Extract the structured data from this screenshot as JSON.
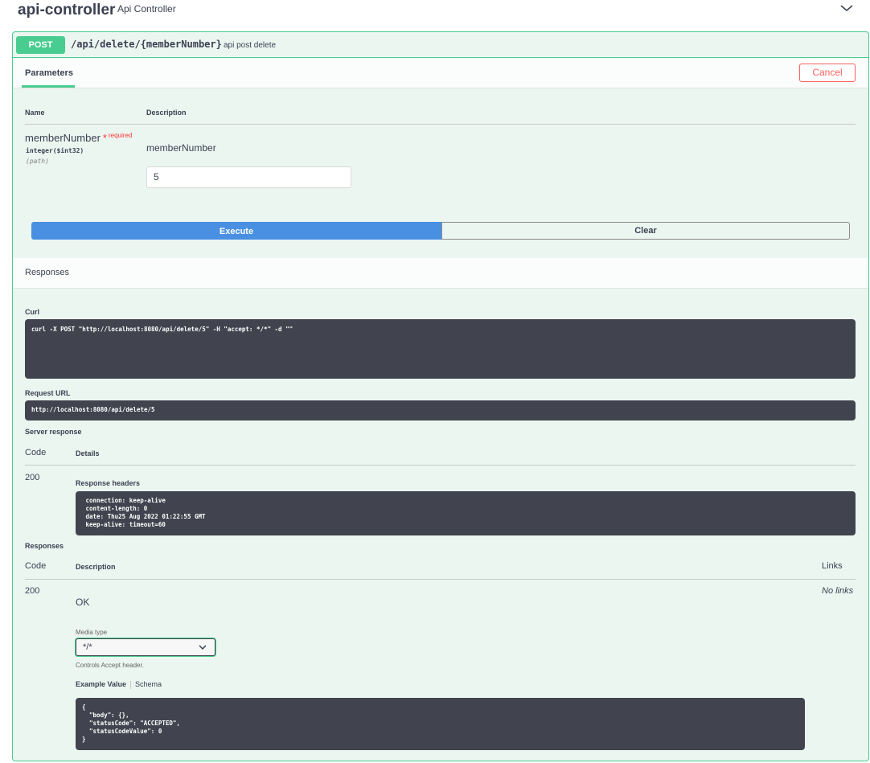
{
  "tag": {
    "name": "api-controller",
    "description": "Api Controller"
  },
  "operation": {
    "method": "POST",
    "path": "/api/delete/{memberNumber}",
    "summary": "api post delete"
  },
  "parameters": {
    "tab_label": "Parameters",
    "cancel_label": "Cancel",
    "col_name": "Name",
    "col_description": "Description",
    "items": [
      {
        "name": "memberNumber",
        "required_star": "*",
        "required_label": "required",
        "type": "integer($int32)",
        "in": "(path)",
        "description": "memberNumber",
        "value": "5"
      }
    ]
  },
  "actions": {
    "execute_label": "Execute",
    "clear_label": "Clear"
  },
  "responses_section": {
    "title": "Responses",
    "curl_label": "Curl",
    "curl_command": "curl -X POST \"http://localhost:8080/api/delete/5\" -H \"accept: */*\" -d \"\"",
    "request_url_label": "Request URL",
    "request_url": "http://localhost:8080/api/delete/5",
    "server_response_label": "Server response",
    "col_code": "Code",
    "col_details": "Details",
    "server_code": "200",
    "response_headers_label": "Response headers",
    "response_headers": " connection: keep-alive \n content-length: 0 \n date: Thu25 Aug 2022 01:22:55 GMT \n keep-alive: timeout=60 "
  },
  "documented_responses": {
    "title": "Responses",
    "col_code": "Code",
    "col_description": "Description",
    "col_links": "Links",
    "items": [
      {
        "code": "200",
        "description": "OK",
        "links": "No links",
        "media_type_label": "Media type",
        "media_type_value": "*/*",
        "controls_text": "Controls Accept header.",
        "example_tab": "Example Value",
        "schema_tab": "Schema",
        "example_value": "{\n  \"body\": {},\n  \"statusCode\": \"ACCEPTED\",\n  \"statusCodeValue\": 0\n}"
      }
    ]
  },
  "colors": {
    "post_green": "#49cc90",
    "block_bg": "#ebf6f1",
    "execute_blue": "#4990e2",
    "cancel_red": "#ff6060",
    "code_bg": "#41444e",
    "text": "#3b4151"
  },
  "icons": {
    "tag_toggle": "chevron-down-icon",
    "media_select": "chevron-down-icon"
  }
}
